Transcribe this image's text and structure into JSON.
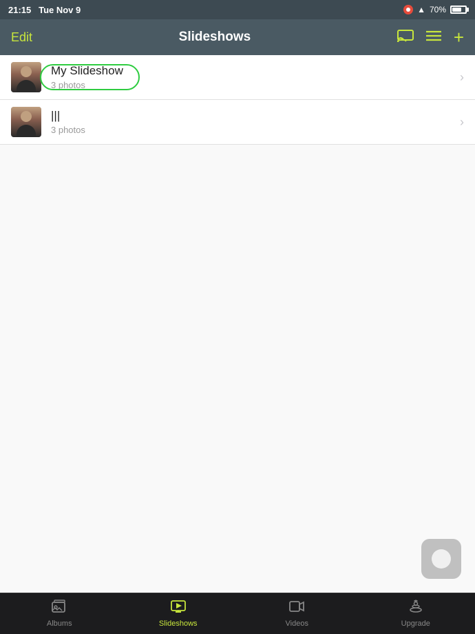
{
  "statusBar": {
    "time": "21:15",
    "day": "Tue Nov 9",
    "batteryLevel": "70%",
    "wifi": "WiFi"
  },
  "navBar": {
    "editLabel": "Edit",
    "title": "Slideshows",
    "castIconName": "cast-icon",
    "menuIconName": "menu-icon",
    "addIconName": "add-icon"
  },
  "slideshows": [
    {
      "name": "My Slideshow",
      "photoCount": "3 photos"
    },
    {
      "name": "|||",
      "photoCount": "3 photos"
    }
  ],
  "tabs": [
    {
      "label": "Albums",
      "icon": "🖼",
      "active": false
    },
    {
      "label": "Slideshows",
      "icon": "📽",
      "active": true
    },
    {
      "label": "Videos",
      "icon": "🎬",
      "active": false
    },
    {
      "label": "Upgrade",
      "icon": "🚀",
      "active": false
    }
  ]
}
